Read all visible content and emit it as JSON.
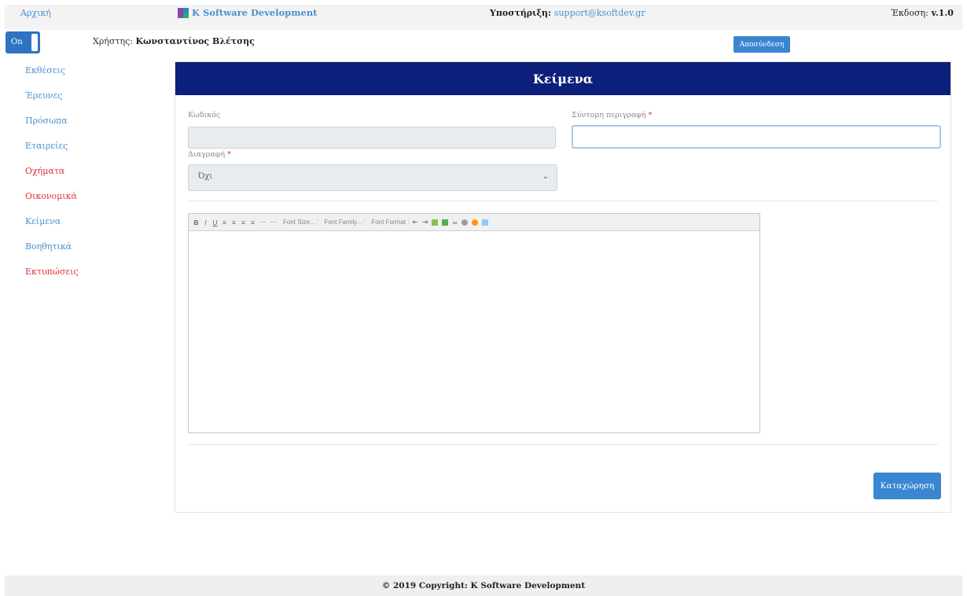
{
  "topbar": {
    "home": "Αρχική",
    "brand": "K Software Development",
    "support_label": "Υποστήριξη:",
    "support_email": "support@ksoftdev.gr",
    "version_label": "Έκδοση:",
    "version_value": "v.1.0"
  },
  "toggle": {
    "label": "On"
  },
  "user": {
    "label": "Χρήστης:",
    "name": "Κωνσταντίνος Βλέτσης"
  },
  "logout": {
    "label": "Αποσύνδεση"
  },
  "sidebar": {
    "items": [
      {
        "label": "Εκθέσεις",
        "color": "#4a8fd0"
      },
      {
        "label": "Έρευνες",
        "color": "#4a8fd0"
      },
      {
        "label": "Πρόσωπα",
        "color": "#4a8fd0"
      },
      {
        "label": "Εταιρείες",
        "color": "#4a8fd0"
      },
      {
        "label": "Οχήματα",
        "color": "#e0323b"
      },
      {
        "label": "Οικονομικά",
        "color": "#e0323b"
      },
      {
        "label": "Κείμενα",
        "color": "#4a8fd0"
      },
      {
        "label": "Βοηθητικά",
        "color": "#4a8fd0"
      },
      {
        "label": "Εκτυπώσεις",
        "color": "#e0323b"
      }
    ]
  },
  "form": {
    "title": "Κείμενα",
    "code_label": "Κωδικός",
    "code_value": "",
    "short_desc_label": "Σύντομη περιγραφή",
    "short_desc_value": "",
    "delete_label": "Διαγραφή",
    "delete_value": "Όχι",
    "required_mark": "*",
    "save_label": "Καταχώρηση"
  },
  "editor": {
    "font_size": "Font Size...",
    "font_family": "Font Family...",
    "font_format": "Font Format",
    "content": ""
  },
  "colors": {
    "header": "#0c1f7a",
    "accent": "#3a86d0",
    "link": "#4a8fd0",
    "danger": "#e0323b"
  },
  "footer": {
    "text": "© 2019 Copyright: K Software Development"
  }
}
